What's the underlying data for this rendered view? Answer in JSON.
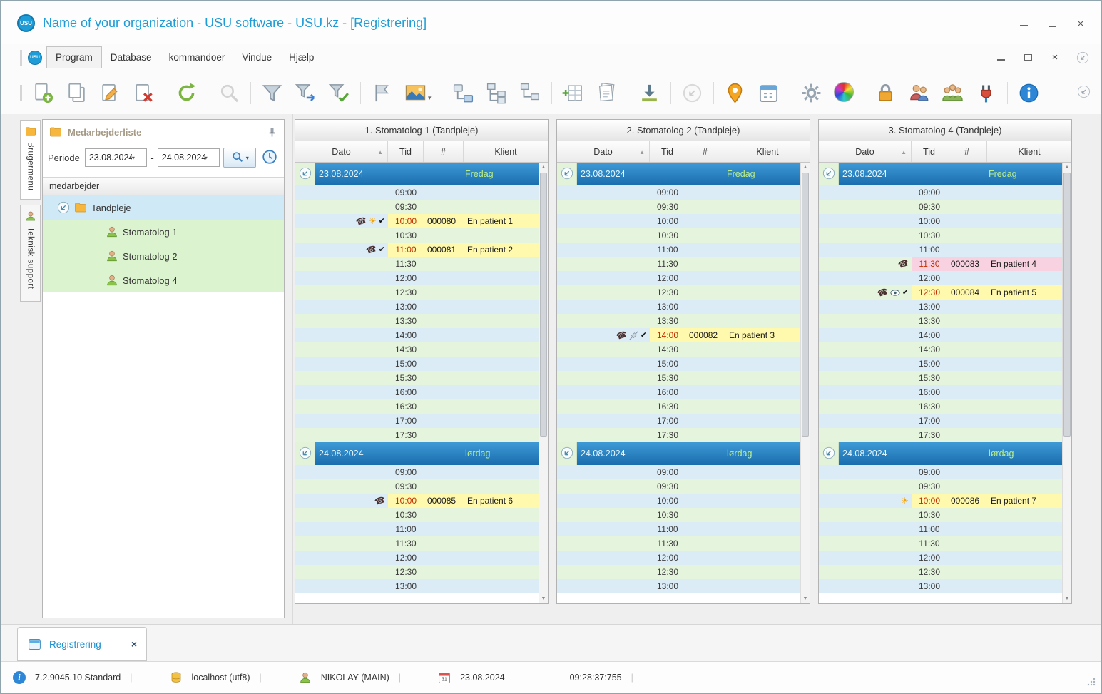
{
  "window": {
    "title": "Name of your organization - USU software - USU.kz - [Registrering]",
    "logo_text": "USU"
  },
  "glyphs": {
    "close": "×",
    "caret_small": "▾",
    "sort_asc": "▲",
    "scroll_up": "▲",
    "scroll_down": "▼",
    "phone": "☎",
    "sun": "☀",
    "check": "✔",
    "info_i": "i"
  },
  "menu": {
    "items": [
      "Program",
      "Database",
      "kommandoer",
      "Vindue",
      "Hjælp"
    ],
    "active": "Program"
  },
  "toolbar": {
    "groups": [
      {
        "buttons": [
          {
            "name": "new-record"
          },
          {
            "name": "duplicate-record"
          },
          {
            "name": "edit-record"
          },
          {
            "name": "delete-record"
          }
        ]
      },
      {
        "buttons": [
          {
            "name": "refresh"
          }
        ]
      },
      {
        "buttons": [
          {
            "name": "search",
            "disabled": true
          }
        ]
      },
      {
        "buttons": [
          {
            "name": "filter"
          },
          {
            "name": "filter-transfer"
          },
          {
            "name": "filter-apply"
          }
        ]
      },
      {
        "buttons": [
          {
            "name": "flag"
          },
          {
            "name": "image-view",
            "caret": true
          }
        ]
      },
      {
        "buttons": [
          {
            "name": "tree-node-add"
          },
          {
            "name": "tree-expand"
          },
          {
            "name": "tree-collapse"
          }
        ]
      },
      {
        "buttons": [
          {
            "name": "add-row"
          },
          {
            "name": "report-copies"
          }
        ]
      },
      {
        "buttons": [
          {
            "name": "import-download"
          }
        ]
      },
      {
        "buttons": [
          {
            "name": "nav-circle",
            "disabled": true
          }
        ]
      },
      {
        "buttons": [
          {
            "name": "location-pin"
          },
          {
            "name": "calendar"
          }
        ]
      },
      {
        "buttons": [
          {
            "name": "settings-gear"
          },
          {
            "name": "color-wheel"
          }
        ]
      },
      {
        "buttons": [
          {
            "name": "lock"
          },
          {
            "name": "user-permissions"
          },
          {
            "name": "user-groups"
          },
          {
            "name": "plugin"
          }
        ]
      },
      {
        "buttons": [
          {
            "name": "info"
          }
        ]
      }
    ]
  },
  "side_tabs": {
    "tabs": [
      {
        "label": "Brugermenu"
      },
      {
        "label": "Teknisk support"
      }
    ]
  },
  "left_panel": {
    "title": "Medarbejderliste",
    "periode_label": "Periode",
    "periode_separator": "-",
    "date_from": "23.08.2024",
    "date_to": "24.08.2024",
    "list_header": "medarbejder",
    "tree_root": "Tandpleje",
    "tree_items": [
      "Stomatolog 1",
      "Stomatolog 2",
      "Stomatolog 4"
    ]
  },
  "schedules": [
    {
      "title": "1. Stomatolog 1 (Tandpleje)",
      "columns": [
        "Dato",
        "Tid",
        "#",
        "Klient"
      ],
      "days": [
        {
          "date": "23.08.2024",
          "day_name": "Fredag",
          "times": [
            "09:00",
            "09:30",
            "10:00",
            "10:30",
            "11:00",
            "11:30",
            "12:00",
            "12:30",
            "13:00",
            "13:30",
            "14:00",
            "14:30",
            "15:00",
            "15:30",
            "16:00",
            "16:30",
            "17:00",
            "17:30"
          ],
          "appointments": {
            "10:00": {
              "number": "000080",
              "client": "En patient 1",
              "icons": [
                "phone",
                "sun",
                "check"
              ],
              "highlight": "yellow"
            },
            "11:00": {
              "number": "000081",
              "client": "En patient 2",
              "icons": [
                "phone",
                "check"
              ],
              "highlight": "yellow"
            }
          }
        },
        {
          "date": "24.08.2024",
          "day_name": "lørdag",
          "times": [
            "09:00",
            "09:30",
            "10:00",
            "10:30",
            "11:00",
            "11:30",
            "12:00",
            "12:30",
            "13:00"
          ],
          "appointments": {
            "10:00": {
              "number": "000085",
              "client": "En patient 6",
              "icons": [
                "phone"
              ],
              "highlight": "yellow"
            }
          }
        }
      ]
    },
    {
      "title": "2. Stomatolog 2 (Tandpleje)",
      "columns": [
        "Dato",
        "Tid",
        "#",
        "Klient"
      ],
      "days": [
        {
          "date": "23.08.2024",
          "day_name": "Fredag",
          "times": [
            "09:00",
            "09:30",
            "10:00",
            "10:30",
            "11:00",
            "11:30",
            "12:00",
            "12:30",
            "13:00",
            "13:30",
            "14:00",
            "14:30",
            "15:00",
            "15:30",
            "16:00",
            "16:30",
            "17:00",
            "17:30"
          ],
          "appointments": {
            "14:00": {
              "number": "000082",
              "client": "En patient 3",
              "icons": [
                "phone",
                "syringe",
                "check"
              ],
              "highlight": "yellow"
            }
          }
        },
        {
          "date": "24.08.2024",
          "day_name": "lørdag",
          "times": [
            "09:00",
            "09:30",
            "10:00",
            "10:30",
            "11:00",
            "11:30",
            "12:00",
            "12:30",
            "13:00"
          ],
          "appointments": {}
        }
      ]
    },
    {
      "title": "3. Stomatolog 4 (Tandpleje)",
      "columns": [
        "Dato",
        "Tid",
        "#",
        "Klient"
      ],
      "days": [
        {
          "date": "23.08.2024",
          "day_name": "Fredag",
          "times": [
            "09:00",
            "09:30",
            "10:00",
            "10:30",
            "11:00",
            "11:30",
            "12:00",
            "12:30",
            "13:00",
            "13:30",
            "14:00",
            "14:30",
            "15:00",
            "15:30",
            "16:00",
            "16:30",
            "17:00",
            "17:30"
          ],
          "appointments": {
            "11:30": {
              "number": "000083",
              "client": "En patient 4",
              "icons": [
                "phone"
              ],
              "highlight": "pink"
            },
            "12:30": {
              "number": "000084",
              "client": "En patient 5",
              "icons": [
                "phone",
                "eye",
                "check"
              ],
              "highlight": "yellow"
            }
          }
        },
        {
          "date": "24.08.2024",
          "day_name": "lørdag",
          "times": [
            "09:00",
            "09:30",
            "10:00",
            "10:30",
            "11:00",
            "11:30",
            "12:00",
            "12:30",
            "13:00"
          ],
          "appointments": {
            "10:00": {
              "number": "000086",
              "client": "En patient 7",
              "icons": [
                "sun"
              ],
              "highlight": "yellow"
            }
          }
        }
      ]
    }
  ],
  "document_tab": {
    "label": "Registrering"
  },
  "status_bar": {
    "version": "7.2.9045.10 Standard",
    "database": "localhost (utf8)",
    "user": "NIKOLAY (MAIN)",
    "date": "23.08.2024",
    "time": "09:28:37:755",
    "calendar_day": "31"
  }
}
